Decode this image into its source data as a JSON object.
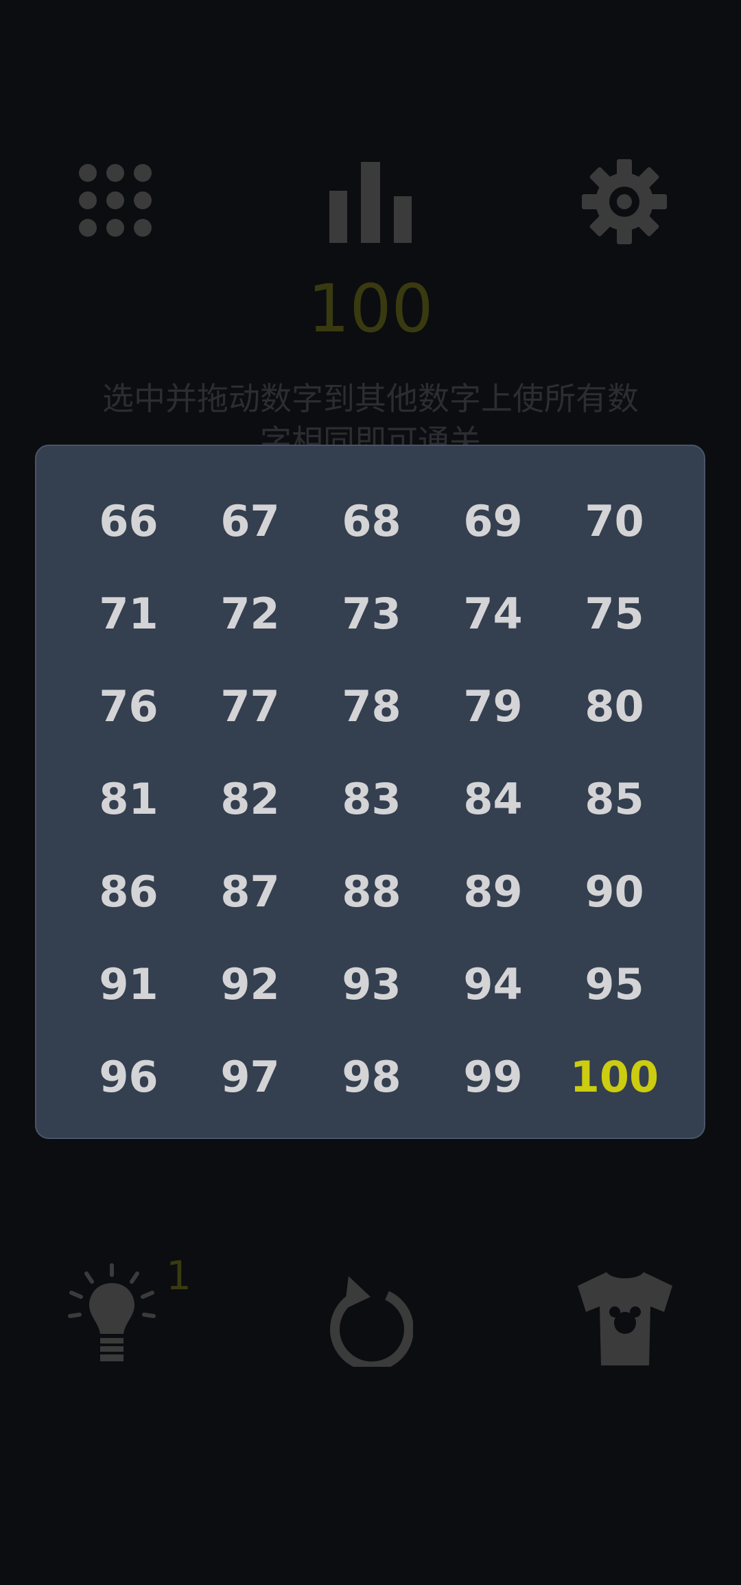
{
  "header": {
    "level_number": "100",
    "instruction": "选中并拖动数字到其他数字上使所有数字相同即可通关",
    "icons": [
      "grid-icon",
      "bar-chart-icon",
      "gear-icon"
    ]
  },
  "level_select": {
    "levels": [
      "66",
      "67",
      "68",
      "69",
      "70",
      "71",
      "72",
      "73",
      "74",
      "75",
      "76",
      "77",
      "78",
      "79",
      "80",
      "81",
      "82",
      "83",
      "84",
      "85",
      "86",
      "87",
      "88",
      "89",
      "90",
      "91",
      "92",
      "93",
      "94",
      "95",
      "96",
      "97",
      "98",
      "99",
      "100"
    ],
    "current_level": "100"
  },
  "footer": {
    "hint_count": "1",
    "icons": [
      "lightbulb-icon",
      "restart-icon",
      "shirt-icon"
    ]
  },
  "colors": {
    "background": "#0b0d10",
    "panel": "#343f50",
    "level_text": "#d4d4d6",
    "current_level": "#cccc10",
    "dim_icon": "#3b3b3b"
  }
}
